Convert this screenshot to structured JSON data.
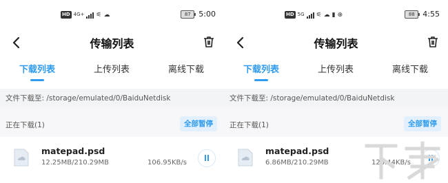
{
  "panels": [
    {
      "status_bar": {
        "time": "5:00",
        "battery": "87",
        "hd": "HD",
        "network": "4G+",
        "extra_icons": [
          "wifi-icon",
          "cloud-icon"
        ]
      },
      "header": {
        "title": "传输列表"
      },
      "tabs": [
        {
          "label": "下载列表",
          "active": true
        },
        {
          "label": "上传列表",
          "active": false
        },
        {
          "label": "离线下载",
          "active": false
        }
      ],
      "path": "文件下载至: /storage/emulated/0/BaiduNetdisk",
      "section": {
        "title": "正在下载(1)",
        "pause_all": "全部暂停"
      },
      "file": {
        "name": "matepad.psd",
        "size": "12.25MB/210.29MB",
        "speed": "106.95KB/s"
      }
    },
    {
      "status_bar": {
        "time": "4:55",
        "battery": "88",
        "hd": "HD",
        "network": "5G",
        "extra_icons": [
          "wifi-icon",
          "cloud-icon",
          "notification-icon",
          "circle-icon"
        ]
      },
      "header": {
        "title": "传输列表"
      },
      "tabs": [
        {
          "label": "下载列表",
          "active": true
        },
        {
          "label": "上传列表",
          "active": false
        },
        {
          "label": "离线下载",
          "active": false
        }
      ],
      "path": "文件下载至: /storage/emulated/0/BaiduNetdisk",
      "section": {
        "title": "正在下载(1)",
        "pause_all": "全部暂停"
      },
      "file": {
        "name": "matepad.psd",
        "size": "6.86MB/210.29MB",
        "speed": "126.44KB/s"
      }
    }
  ],
  "colors": {
    "accent": "#2e9bf0",
    "path_bg": "#f3f4f6",
    "section_bg": "#f7f7f9"
  }
}
